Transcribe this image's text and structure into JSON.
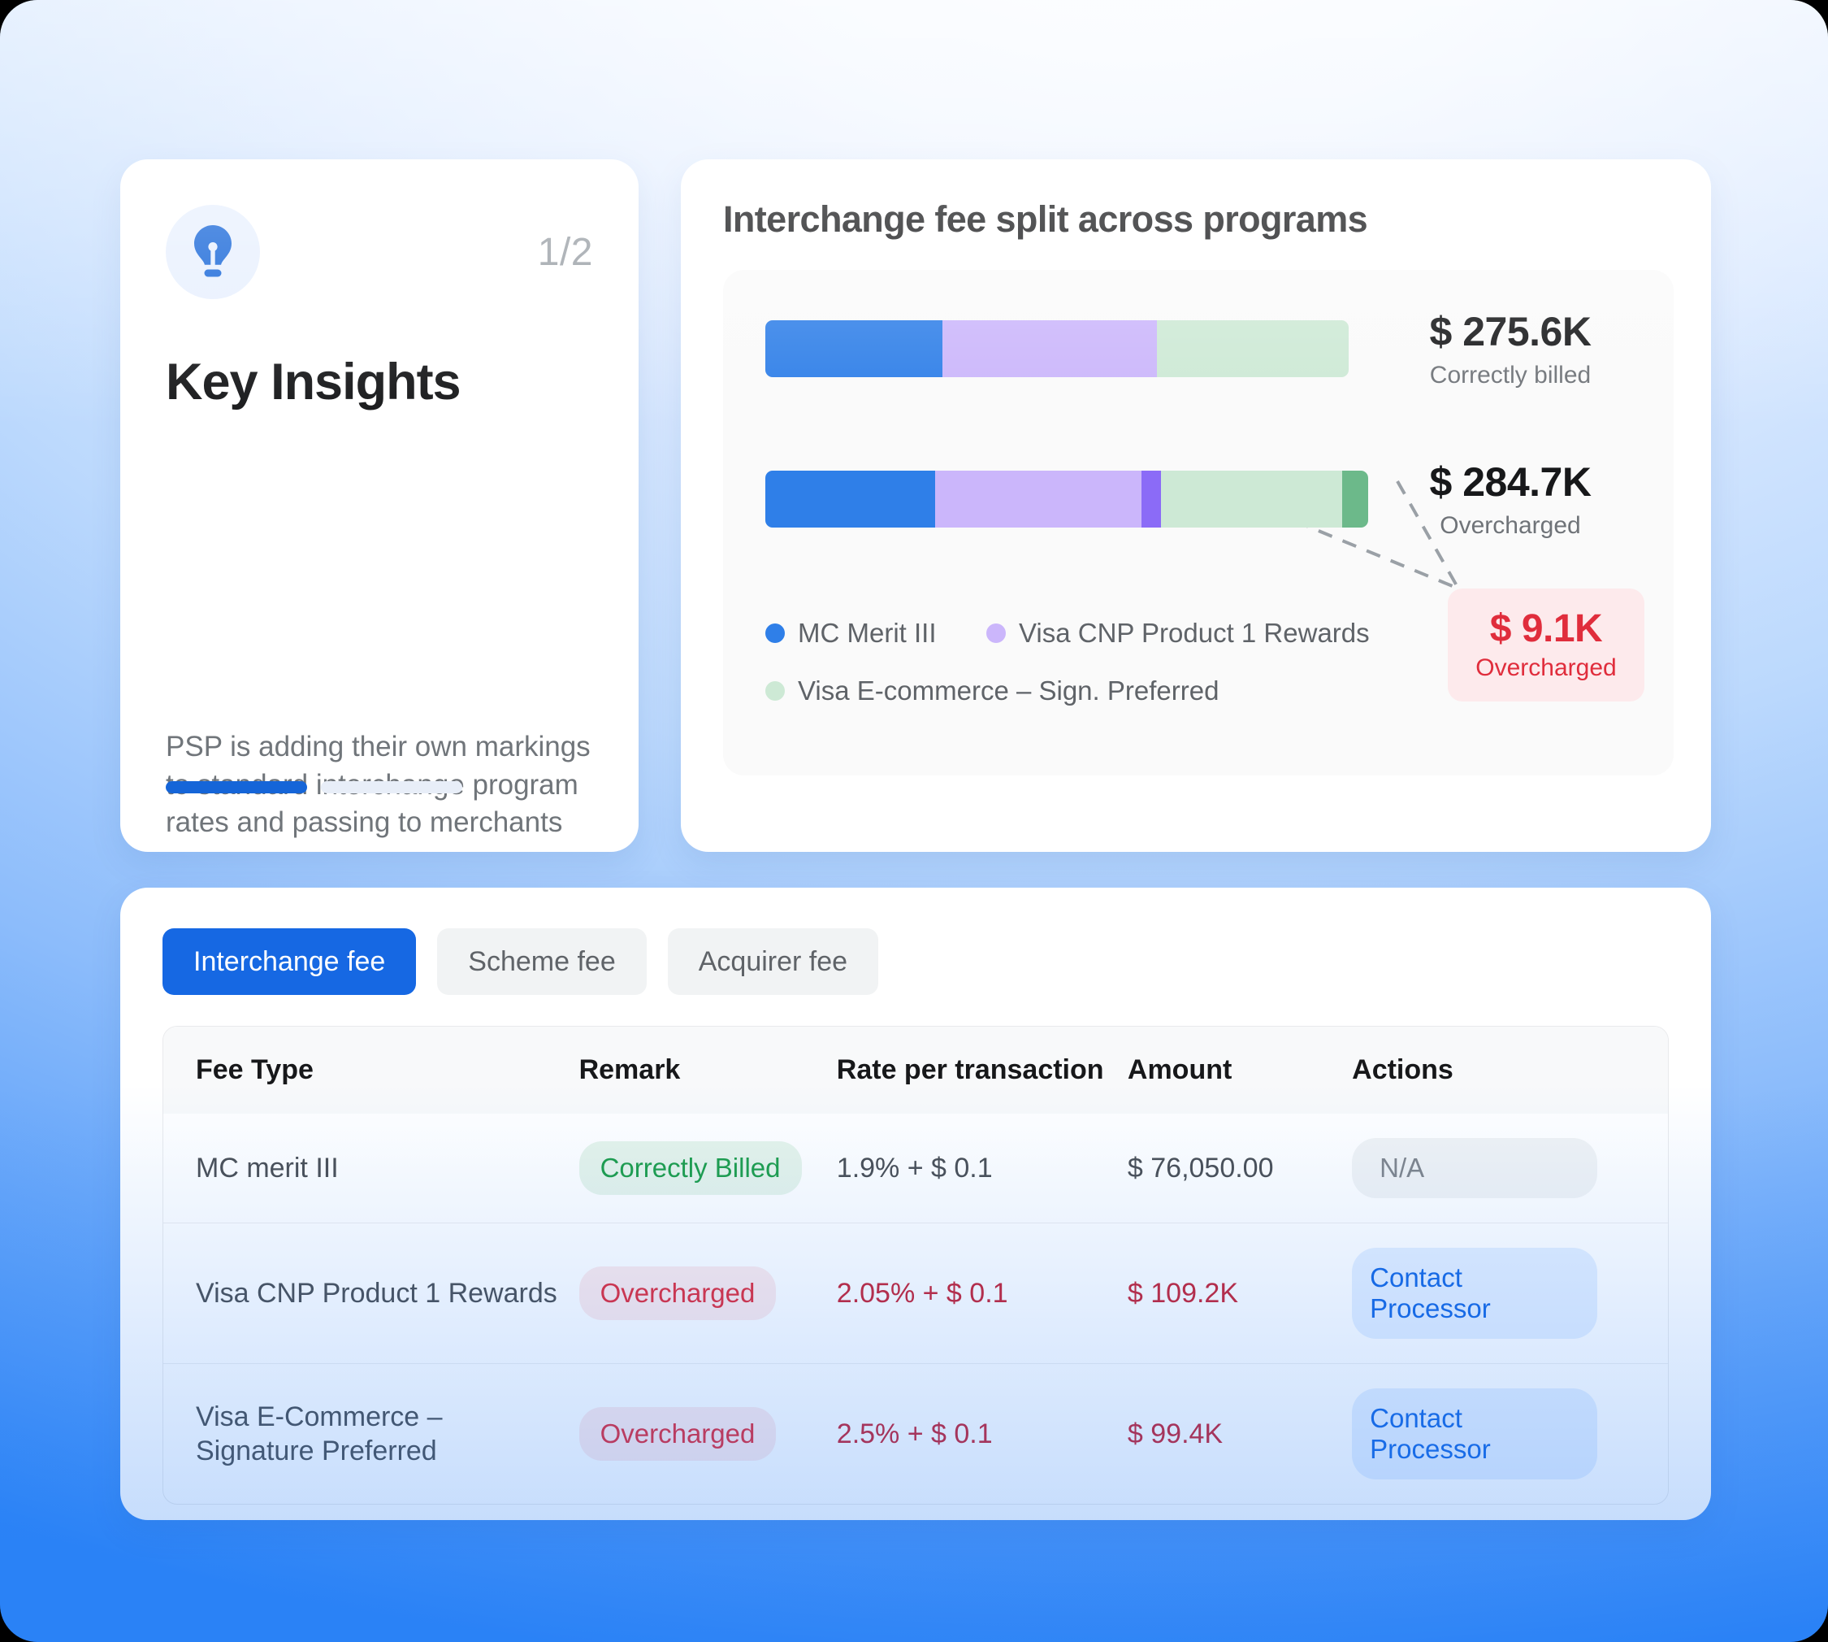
{
  "insights": {
    "icon": "lightbulb-icon",
    "counter": "1/2",
    "title": "Key Insights",
    "body": "PSP is adding their own markings to standard interchange program rates and passing to merchants",
    "progress": {
      "current": 1,
      "total": 2
    }
  },
  "chart_card": {
    "title": "Interchange fee split across programs"
  },
  "chart_data": {
    "type": "bar",
    "orientation": "horizontal",
    "stacked": true,
    "title": "Interchange fee split across programs",
    "categories": [
      "Correctly billed",
      "Overcharged"
    ],
    "legend": [
      {
        "label": "MC Merit III",
        "color": "#2f7fe8"
      },
      {
        "label": "Visa CNP Product 1 Rewards",
        "color": "#cbb6fb"
      },
      {
        "label": "Visa E-commerce – Sign. Preferred",
        "color": "#cde9d5"
      }
    ],
    "legend_position": "bottom-left",
    "bars": [
      {
        "amount": "$ 275.6K",
        "sublabel": "Correctly billed",
        "segments": [
          {
            "name": "MC Merit III",
            "color": "#2f7fe8",
            "width_pct": 30.4
          },
          {
            "name": "Visa CNP Product 1 Rewards",
            "color": "#cbb6fb",
            "width_pct": 36.8
          },
          {
            "name": "Visa E-commerce – Sign. Preferred",
            "color": "#cde9d5",
            "width_pct": 32.8
          }
        ]
      },
      {
        "amount": "$ 284.7K",
        "sublabel": "Overcharged",
        "segments": [
          {
            "name": "MC Merit III",
            "color": "#2f7fe8",
            "width_pct": 28.2
          },
          {
            "name": "Visa CNP Product 1 Rewards",
            "color": "#cbb6fb",
            "width_pct": 34.2
          },
          {
            "name": "Visa CNP Product 1 Rewards overcharge",
            "color": "#8b6bf7",
            "width_pct": 3.3
          },
          {
            "name": "Visa E-commerce – Sign. Preferred",
            "color": "#cde9d5",
            "width_pct": 30.0
          },
          {
            "name": "Visa E-commerce overcharge",
            "color": "#6cb98a",
            "width_pct": 4.3
          }
        ]
      }
    ],
    "callout": {
      "amount": "$ 9.1K",
      "sublabel": "Overcharged",
      "color": "#e02d3c",
      "background": "#fdeaec"
    }
  },
  "fees": {
    "tabs": [
      {
        "label": "Interchange fee",
        "active": true
      },
      {
        "label": "Scheme fee",
        "active": false
      },
      {
        "label": "Acquirer fee",
        "active": false
      }
    ],
    "columns": [
      "Fee Type",
      "Remark",
      "Rate per transaction",
      "Amount",
      "Actions"
    ],
    "rows": [
      {
        "fee_type": "MC merit III",
        "remark": "Correctly Billed",
        "remark_state": "ok",
        "rate": "1.9% + $ 0.1",
        "amount": "$ 76,050.00",
        "action": "N/A",
        "action_state": "disabled"
      },
      {
        "fee_type": "Visa CNP Product 1 Rewards",
        "remark": "Overcharged",
        "remark_state": "bad",
        "rate": "2.05% + $ 0.1",
        "amount": "$ 109.2K",
        "action": "Contact Processor",
        "action_state": "link"
      },
      {
        "fee_type_line1": "Visa E-Commerce –",
        "fee_type_line2": "Signature Preferred",
        "remark": "Overcharged",
        "remark_state": "bad",
        "rate": "2.5% + $ 0.1",
        "amount": "$ 99.4K",
        "action": "Contact Processor",
        "action_state": "link"
      }
    ]
  }
}
